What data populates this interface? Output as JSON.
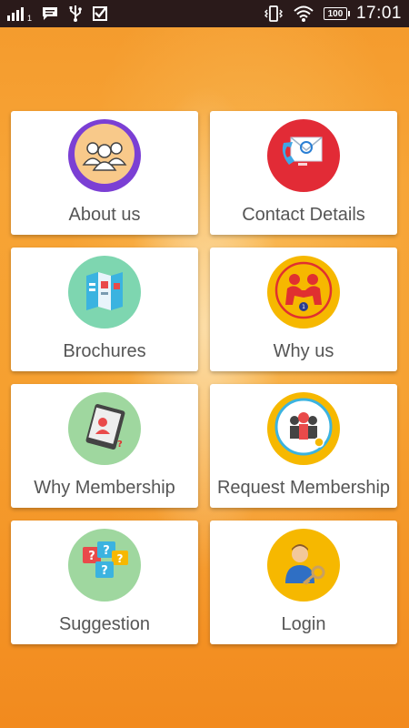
{
  "status_bar": {
    "signal_sub": "1",
    "battery": "100",
    "time": "17:01"
  },
  "menu": [
    {
      "label": "About us",
      "icon": "team-icon",
      "circle_color": "#7b3fd4"
    },
    {
      "label": "Contact Details",
      "icon": "contact-email-icon",
      "circle_color": "#e22b36"
    },
    {
      "label": "Brochures",
      "icon": "brochure-icon",
      "circle_color": "#7ed6b0"
    },
    {
      "label": "Why us",
      "icon": "handshake-icon",
      "circle_color": "#f6b800"
    },
    {
      "label": "Why Membership",
      "icon": "membership-card-icon",
      "circle_color": "#9fd79f"
    },
    {
      "label": "Request Membership",
      "icon": "group-request-icon",
      "circle_color": "#f6b800"
    },
    {
      "label": "Suggestion",
      "icon": "question-bubbles-icon",
      "circle_color": "#9fd79f"
    },
    {
      "label": "Login",
      "icon": "user-key-icon",
      "circle_color": "#f6b800"
    }
  ]
}
